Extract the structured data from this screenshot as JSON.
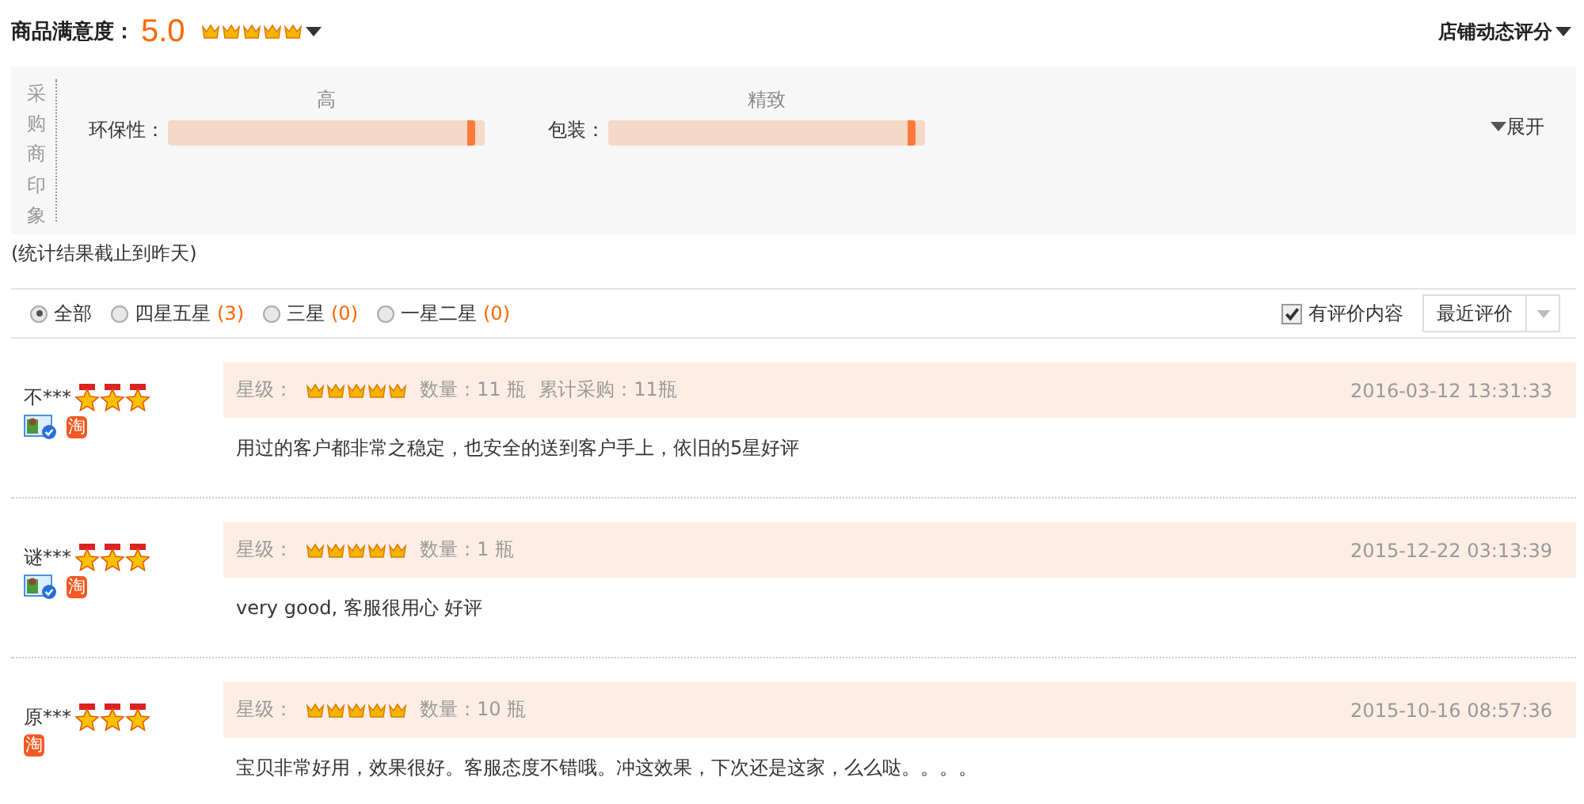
{
  "header": {
    "label": "商品满意度：",
    "score": "5.0",
    "stars": 5,
    "shop_rating": "店铺动态评分"
  },
  "impressions": {
    "title": "采购商印象",
    "items": [
      {
        "label": "环保性：",
        "tag": "高",
        "level": 0.97
      },
      {
        "label": "包装：",
        "tag": "精致",
        "level": 0.97
      }
    ],
    "expand": "展开"
  },
  "note": "(统计结果截止到昨天)",
  "filters": [
    {
      "label": "全部",
      "selected": true
    },
    {
      "label": "四星五星",
      "count": "(3)",
      "selected": false
    },
    {
      "label": "三星",
      "count": "(0)",
      "selected": false
    },
    {
      "label": "一星二星",
      "count": "(0)",
      "selected": false
    }
  ],
  "has_content": {
    "label": "有评价内容",
    "checked": true
  },
  "sort": {
    "value": "最近评价"
  },
  "reviews": [
    {
      "user": "不***",
      "buyer_level": {
        "stars": 3
      },
      "verified": true,
      "badge": "淘",
      "rating_label": "星级：",
      "stars": 5,
      "quantity": "数量：11 瓶",
      "total": "累计采购：11瓶",
      "date": "2016-03-12 13:31:33",
      "text": "用过的客户都非常之稳定，也安全的送到客户手上，依旧的5星好评"
    },
    {
      "user": "谜***",
      "buyer_level": {
        "stars": 3
      },
      "verified": true,
      "badge": "淘",
      "rating_label": "星级：",
      "stars": 5,
      "quantity": "数量：1 瓶",
      "date": "2015-12-22 03:13:39",
      "text": "very good, 客服很用心 好评"
    },
    {
      "user": "原***",
      "buyer_level": {
        "stars": 3
      },
      "verified": false,
      "badge": "淘",
      "rating_label": "星级：",
      "stars": 5,
      "quantity": "数量：10 瓶",
      "date": "2015-10-16 08:57:36",
      "text": "宝贝非常好用，效果很好。客服态度不错哦。冲这效果，下次还是这家，么么哒。。。。"
    }
  ]
}
